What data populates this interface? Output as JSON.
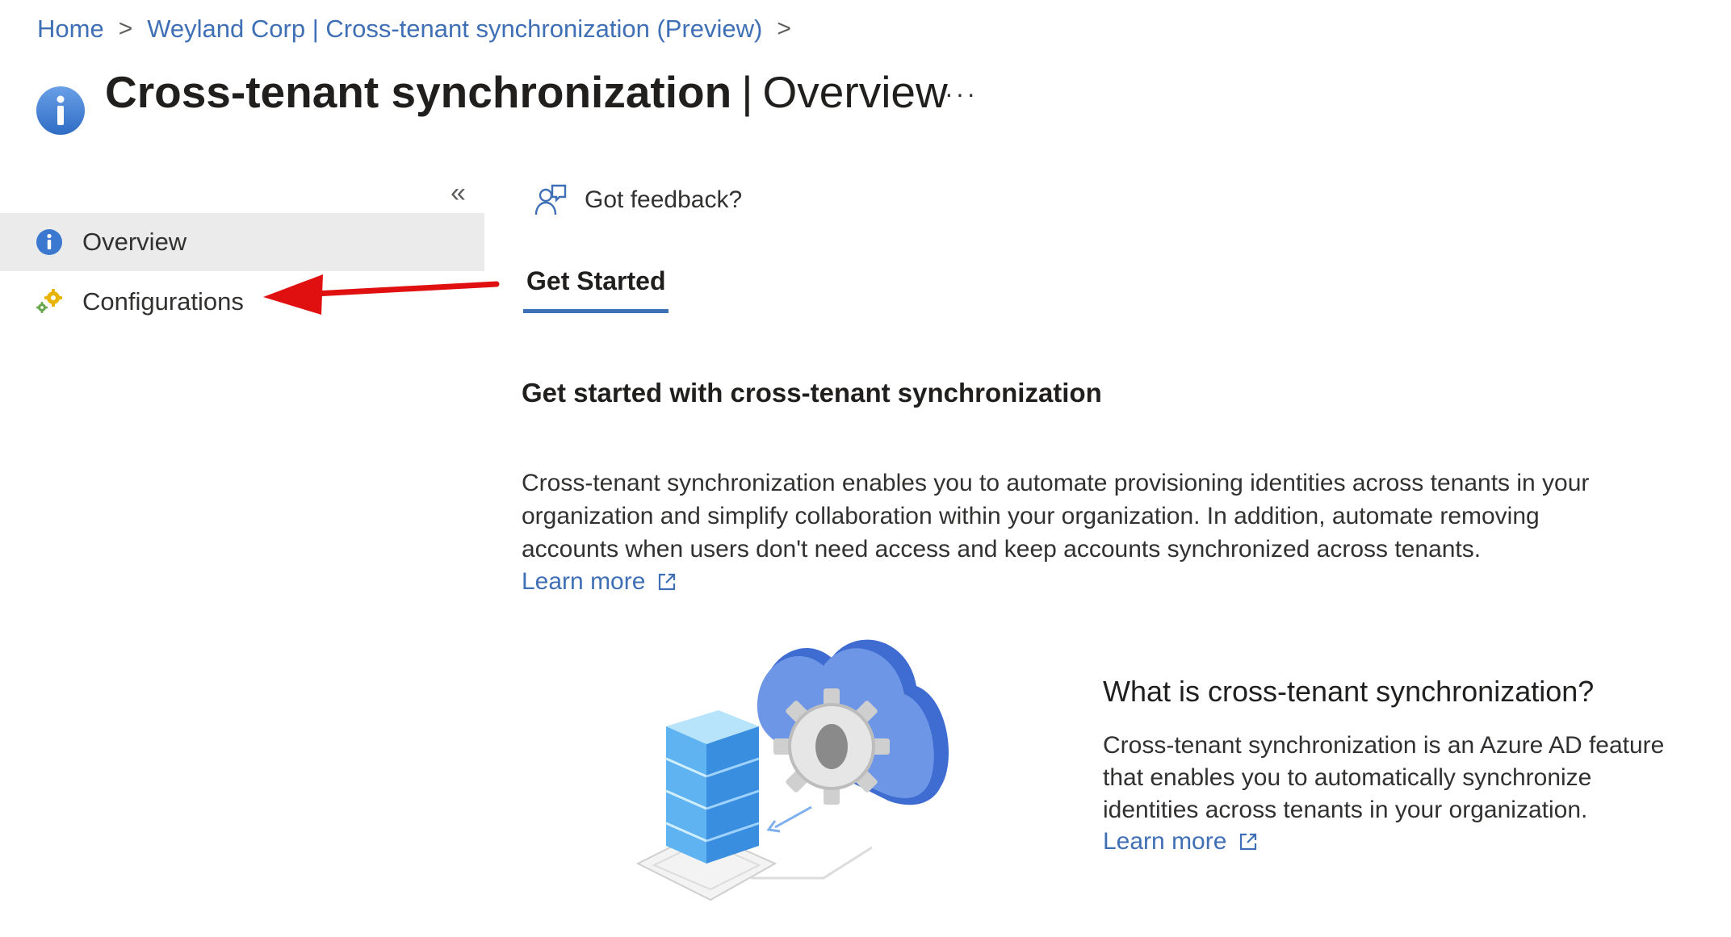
{
  "breadcrumb": {
    "items": [
      "Home",
      "Weyland Corp | Cross-tenant synchronization (Preview)"
    ],
    "separator": ">"
  },
  "header": {
    "title_main": "Cross-tenant synchronization",
    "title_separator": "|",
    "title_sub": "Overview",
    "more_label": "···",
    "icon": "info-icon"
  },
  "sidebar": {
    "collapse_label": "«",
    "items": [
      {
        "label": "Overview",
        "icon": "info-icon",
        "active": true
      },
      {
        "label": "Configurations",
        "icon": "gears-icon",
        "active": false
      }
    ]
  },
  "main": {
    "feedback_label": "Got feedback?",
    "tabs": [
      {
        "label": "Get Started",
        "active": true
      }
    ],
    "section_title": "Get started with cross-tenant synchronization",
    "description": "Cross-tenant synchronization enables you to automate provisioning identities across tenants in your organization and simplify collaboration within your organization. In addition, automate removing accounts when users don't need access and keep accounts synchronized across tenants.",
    "learn_more": "Learn more",
    "what_title": "What is cross-tenant synchronization?",
    "what_description": "Cross-tenant synchronization is an Azure AD feature that enables you to automatically synchronize identities across tenants in your organization.",
    "what_learn_more": "Learn more"
  },
  "colors": {
    "accent": "#3f6fb5",
    "active_nav_bg": "#ebebeb",
    "annotation_arrow": "#e01010"
  }
}
